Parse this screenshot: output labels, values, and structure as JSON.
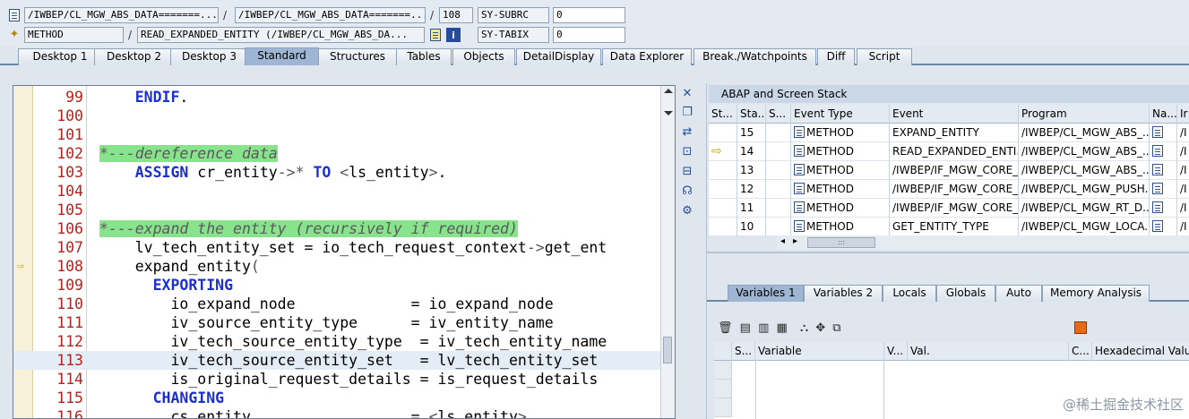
{
  "top": {
    "row1": {
      "program_1": "/IWBEP/CL_MGW_ABS_DATA=======...",
      "program_2": "/IWBEP/CL_MGW_ABS_DATA=======...",
      "line": "108",
      "sysvar_1_name": "SY-SUBRC",
      "sysvar_1_value": "0"
    },
    "row2": {
      "event_type": "METHOD",
      "event_name": "READ_EXPANDED_ENTITY (/IWBEP/CL_MGW_ABS_DA...",
      "sysvar_2_name": "SY-TABIX",
      "sysvar_2_value": "0"
    },
    "separator": "/"
  },
  "tabs": [
    "Desktop 1",
    "Desktop 2",
    "Desktop 3",
    "Standard",
    "Structures",
    "Tables",
    "Objects",
    "DetailDisplay",
    "Data Explorer",
    "Break./Watchpoints",
    "Diff",
    "Script"
  ],
  "active_tab": "Standard",
  "code": [
    {
      "ln": "99",
      "parts": [
        [
          "",
          "    "
        ],
        [
          "kw",
          "ENDIF"
        ],
        [
          "",
          "."
        ]
      ]
    },
    {
      "ln": "100",
      "parts": []
    },
    {
      "ln": "101",
      "parts": []
    },
    {
      "ln": "102",
      "parts": [
        [
          "cm",
          "*---dereference data"
        ]
      ]
    },
    {
      "ln": "103",
      "parts": [
        [
          "",
          "    "
        ],
        [
          "kw",
          "ASSIGN"
        ],
        [
          "",
          " cr_entity"
        ],
        [
          "op",
          "->*"
        ],
        [
          "",
          " "
        ],
        [
          "kw",
          "TO"
        ],
        [
          "",
          " "
        ],
        [
          "op",
          "<"
        ],
        [
          "",
          "ls_entity"
        ],
        [
          "op",
          ">"
        ],
        [
          "",
          "."
        ]
      ]
    },
    {
      "ln": "104",
      "parts": []
    },
    {
      "ln": "105",
      "parts": []
    },
    {
      "ln": "106",
      "parts": [
        [
          "cm",
          "*---expand the entity (recursively if required)"
        ]
      ]
    },
    {
      "ln": "107",
      "parts": [
        [
          "",
          "    lv_tech_entity_set = io_tech_request_context"
        ],
        [
          "op",
          "->"
        ],
        [
          "",
          "get_ent"
        ]
      ]
    },
    {
      "ln": "108",
      "parts": [
        [
          "",
          "    expand_entity"
        ],
        [
          "op",
          "("
        ]
      ],
      "current": true
    },
    {
      "ln": "109",
      "parts": [
        [
          "",
          "      "
        ],
        [
          "kw",
          "EXPORTING"
        ]
      ]
    },
    {
      "ln": "110",
      "parts": [
        [
          "",
          "        io_expand_node             = io_expand_node"
        ]
      ]
    },
    {
      "ln": "111",
      "parts": [
        [
          "",
          "        iv_source_entity_type      = iv_entity_name"
        ]
      ]
    },
    {
      "ln": "112",
      "parts": [
        [
          "",
          "        iv_tech_source_entity_type  = iv_tech_entity_name"
        ]
      ]
    },
    {
      "ln": "113",
      "parts": [
        [
          "",
          "        iv_tech_source_entity_set   = lv_tech_entity_set"
        ]
      ],
      "highlight": true
    },
    {
      "ln": "114",
      "parts": [
        [
          "",
          "        is_original_request_details = is_request_details"
        ]
      ]
    },
    {
      "ln": "115",
      "parts": [
        [
          "",
          "      "
        ],
        [
          "kw",
          "CHANGING"
        ]
      ]
    },
    {
      "ln": "116",
      "parts": [
        [
          "",
          "        cs_entity                  = "
        ],
        [
          "op",
          "<"
        ],
        [
          "",
          "ls_entity"
        ],
        [
          "op",
          ">"
        ]
      ]
    }
  ],
  "stack_panel": {
    "title": "ABAP and Screen Stack",
    "columns": [
      "St...",
      "Sta...",
      "S...",
      "Event Type",
      "Event",
      "Program",
      "Na...",
      "Ir"
    ],
    "rows": [
      {
        "level": "15",
        "type": "METHOD",
        "event": "EXPAND_ENTITY",
        "program": "/IWBEP/CL_MGW_ABS_...",
        "inc": "/I",
        "current": false
      },
      {
        "level": "14",
        "type": "METHOD",
        "event": "READ_EXPANDED_ENTI...",
        "program": "/IWBEP/CL_MGW_ABS_...",
        "inc": "/I",
        "current": true
      },
      {
        "level": "13",
        "type": "METHOD",
        "event": "/IWBEP/IF_MGW_CORE_...",
        "program": "/IWBEP/CL_MGW_ABS_...",
        "inc": "/I",
        "current": false
      },
      {
        "level": "12",
        "type": "METHOD",
        "event": "/IWBEP/IF_MGW_CORE_...",
        "program": "/IWBEP/CL_MGW_PUSH...",
        "inc": "/I",
        "current": false
      },
      {
        "level": "11",
        "type": "METHOD",
        "event": "/IWBEP/IF_MGW_CORE_...",
        "program": "/IWBEP/CL_MGW_RT_D...",
        "inc": "/I",
        "current": false
      },
      {
        "level": "10",
        "type": "METHOD",
        "event": "GET_ENTITY_TYPE",
        "program": "/IWBEP/CL_MGW_LOCA...",
        "inc": "/I",
        "current": false
      }
    ],
    "hscroll_grip": ":::"
  },
  "var_tabs": [
    "Variables 1",
    "Variables 2",
    "Locals",
    "Globals",
    "Auto",
    "Memory Analysis"
  ],
  "active_var_tab": "Variables 1",
  "var_columns": [
    "S...",
    "Variable",
    "V...",
    "Val.",
    "C...",
    "Hexadecimal Value"
  ],
  "watermark": "@稀土掘金技术社区"
}
